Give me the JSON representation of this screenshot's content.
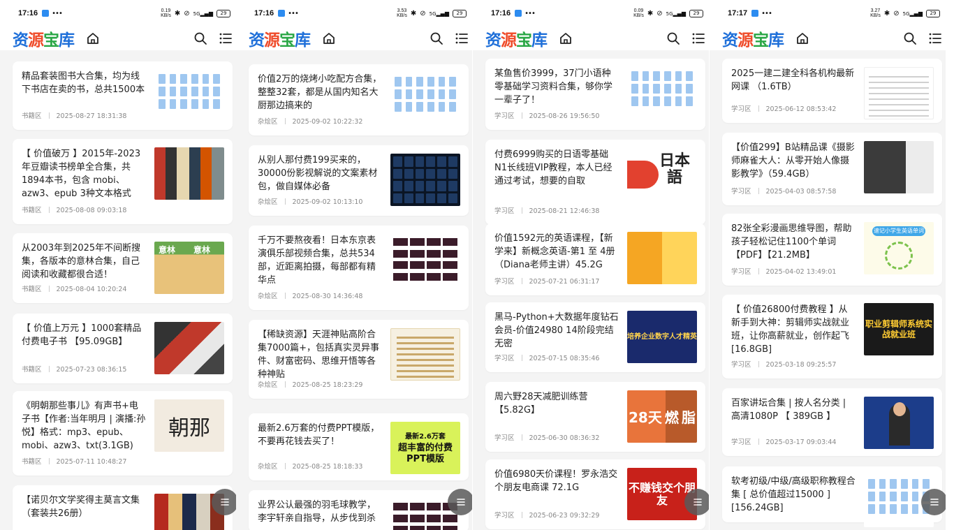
{
  "logo": [
    "资",
    "源",
    "宝",
    "库"
  ],
  "panels": [
    {
      "status": {
        "time": "17:16",
        "speed_top": "0.19",
        "speed_unit": "KB/s",
        "signal": "5G",
        "battery": "29"
      },
      "cards": [
        {
          "title": "精品套装图书大合集，均为线下书店在卖的书，总共1500本",
          "category": "书籍区",
          "date": "2025-08-27 18:31:38",
          "thumb": "files"
        },
        {
          "title": "【 价值破万 】2015年-2023年豆瓣读书榜单全合集，共 1894本书，包含 mobi、azw3、epub 3种文本格式",
          "category": "书籍区",
          "date": "2025-08-08 09:03:18",
          "thumb": "books"
        },
        {
          "title": "从2003年到2025年不间断搜集，各版本的意林合集，自己阅读和收藏都很合适！",
          "category": "书籍区",
          "date": "2025-08-04 10:20:24",
          "thumb": "yilin"
        },
        {
          "title": "【 价值上万元 】1000套精品付费电子书 【95.09GB】",
          "category": "书籍区",
          "date": "2025-07-23 08:36:15",
          "thumb": "ebook"
        },
        {
          "title": "《明朝那些事儿》有声书+电子书【作者:当年明月 | 演播:孙悦】格式：mp3、epub、mobi、azw3、txt(3.1GB)",
          "category": "书籍区",
          "date": "2025-07-11 10:48:27",
          "thumb": "ming"
        },
        {
          "title": "【诺贝尔文学奖得主莫言文集（套装共26册）",
          "category": "",
          "date": "",
          "thumb": "mo"
        }
      ]
    },
    {
      "status": {
        "time": "17:16",
        "speed_top": "3.53",
        "speed_unit": "KB/s",
        "signal": "5G",
        "battery": "29"
      },
      "cards": [
        {
          "title": "价值2万的烧烤小吃配方合集，整整32套，都是从国内知名大厨那边搞来的",
          "category": "杂烩区",
          "date": "2025-09-02 10:22:32",
          "thumb": "files"
        },
        {
          "title": "从别人那付费199买来的，30000份影视解说的文案素材包，做自媒体必备",
          "category": "杂烩区",
          "date": "2025-09-02 10:13:10",
          "thumb": "dark"
        },
        {
          "title": "千万不要熬夜看！日本东京表演俱乐部视频合集，总共534部，近距离拍摄，每部都有精华点",
          "category": "杂烩区",
          "date": "2025-08-30 14:36:48",
          "thumb": "vid"
        },
        {
          "title": "【稀缺资源】天涯神贴高阶合集7000篇+，包括真实灵异事件、财富密码、思维开悟等各种神贴",
          "category": "杂烩区",
          "date": "2025-08-25 18:23:29",
          "thumb": "doc"
        },
        {
          "title": "最新2.6万套的付费PPT模版，不要再花钱去买了！",
          "category": "杂烩区",
          "date": "2025-08-25 18:18:33",
          "thumb": "ppt"
        },
        {
          "title": "业界公认最强的羽毛球教学，李宇轩亲自指导，从步伐到杀",
          "category": "",
          "date": "",
          "thumb": "vid"
        }
      ]
    },
    {
      "status": {
        "time": "17:16",
        "speed_top": "0.09",
        "speed_unit": "KB/s",
        "signal": "5G",
        "battery": "29"
      },
      "cards": [
        {
          "title": "某鱼售价3999，37门小语种零基础学习资料合集，够你学一辈子了！",
          "category": "学习区",
          "date": "2025-08-26 19:56:50",
          "thumb": "files"
        },
        {
          "title": "付费6999购买的日语零基础N1长线班VIP教程，本人已经通过考试，想要的自取",
          "category": "学习区",
          "date": "2025-08-21 12:46:38",
          "thumb": "jp"
        },
        {
          "title": "价值1592元的英语课程，【新学来】新概念英语-第1 至 4册（Diana老师主讲）45.2G",
          "category": "学习区",
          "date": "2025-07-21 06:31:17",
          "thumb": "eng"
        },
        {
          "title": "黑马-Python+大数据年度钻石会员-价值24980 14阶段完结无密",
          "category": "学习区",
          "date": "2025-07-15 08:35:46",
          "thumb": "py"
        },
        {
          "title": "周六野28天减肥训练营【5.82G】",
          "category": "学习区",
          "date": "2025-06-30 08:36:32",
          "thumb": "fit"
        },
        {
          "title": "价值6980天价课程！罗永浩交个朋友电商课 72.1G",
          "category": "学习区",
          "date": "2025-06-23 09:32:29",
          "thumb": "luo"
        }
      ]
    },
    {
      "status": {
        "time": "17:17",
        "speed_top": "3.27",
        "speed_unit": "KB/s",
        "signal": "5G",
        "battery": "29"
      },
      "cards": [
        {
          "title": "2025一建二建全科各机构最新网课 （1.6TB）",
          "category": "学习区",
          "date": "2025-06-12 08:53:42",
          "thumb": "tbl"
        },
        {
          "title": "【价值299】B站精品课《摄影师麻雀大人：从零开始人像摄影教学》（59.4GB）",
          "category": "学习区",
          "date": "2025-04-03 08:57:58",
          "thumb": "photo"
        },
        {
          "title": "82张全彩漫画思维导图，帮助孩子轻松记住1100个单词【PDF】【21.2MB】",
          "category": "学习区",
          "date": "2025-04-02 13:49:01",
          "thumb": "mind"
        },
        {
          "title": "【 价值26800付费教程 】从新手到大神：剪辑师实战就业班，让你高薪就业，创作起飞[16.8GB]",
          "category": "学习区",
          "date": "2025-03-18 09:25:57",
          "thumb": "edit"
        },
        {
          "title": "百家讲坛合集 | 按人名分类 | 高清1080P 【 389GB 】",
          "category": "学习区",
          "date": "2025-03-17 09:03:44",
          "thumb": "lect"
        },
        {
          "title": "软考初级/中级/高级职称教程合集 [ 总价值超过15000 ] [156.24GB]",
          "category": "",
          "date": "",
          "thumb": "files"
        }
      ]
    }
  ],
  "thumb_text": {
    "yilin_a": "意林",
    "yilin_b": "意林",
    "ming": "朝那",
    "jp": "日本語",
    "ppt_top": "最新2.6万套",
    "ppt_a": "超丰富的付费",
    "ppt_b": "PPT模版",
    "py": "培养企业数字人才精英",
    "fit_a": "28天",
    "fit_b": "燃",
    "fit_c": "脂",
    "luo": "不赚钱交个朋友",
    "mind": "速记小学生英语单词",
    "edit": "职业剪辑师系统实战就业班"
  }
}
